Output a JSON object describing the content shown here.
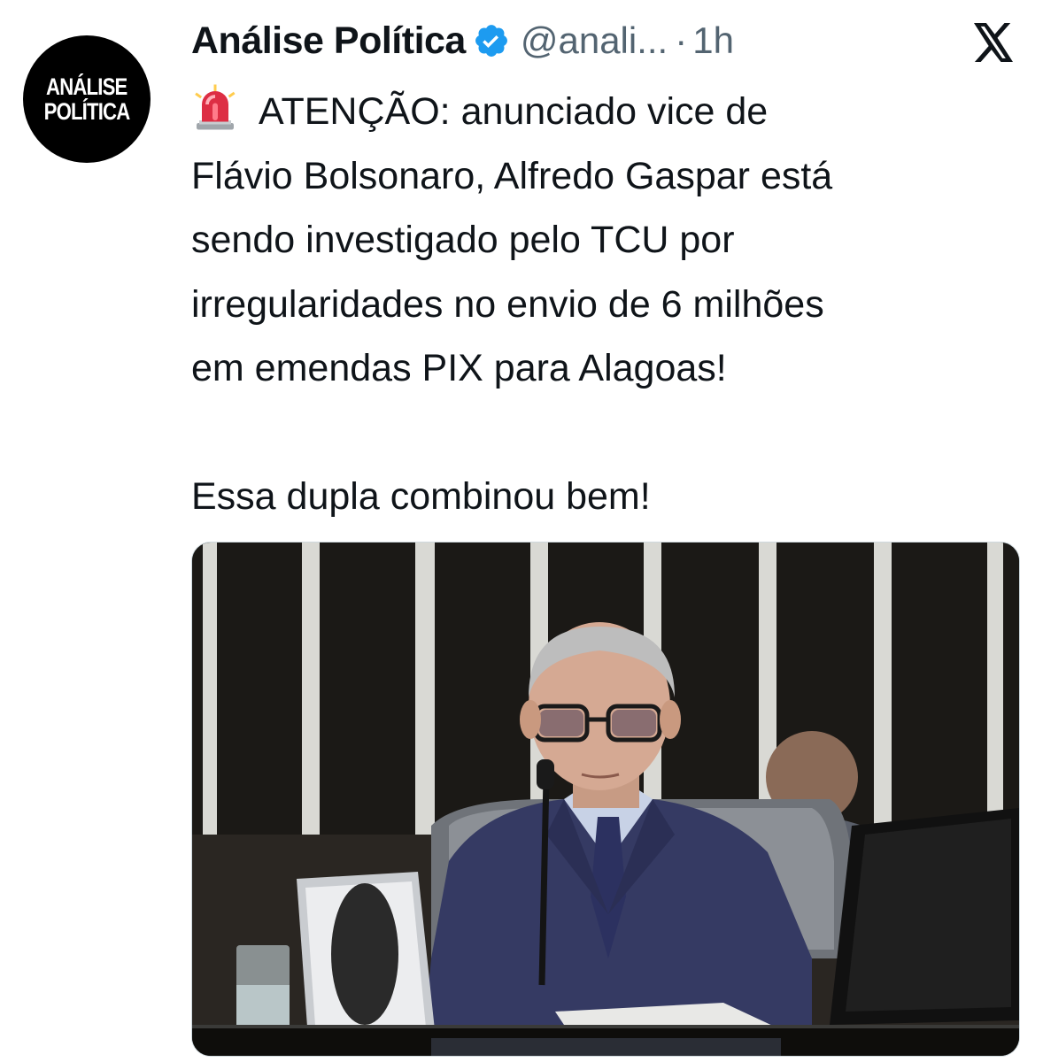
{
  "author": {
    "display_name": "Análise Política",
    "handle": "@anali...",
    "separator": "·",
    "time": "1h",
    "avatar_lines": [
      "ANÁLISE",
      "POLÍTICA"
    ],
    "verified_color": "#1d9bf0"
  },
  "platform": {
    "logo_icon": "x-logo-icon"
  },
  "tweet": {
    "lines": [
      "ATENÇÃO: anunciado vice de",
      "Flávio Bolsonaro, Alfredo Gaspar está",
      "sendo investigado pelo TCU por",
      "irregularidades no envio de 6 milhões",
      "em emendas PIX para Alagoas!"
    ],
    "closing": "Essa dupla combinou bem!",
    "emoji_icon": "rotating-light-icon"
  },
  "colors": {
    "text": "#0f1419",
    "secondary": "#536471",
    "border": "#cfd9de"
  }
}
